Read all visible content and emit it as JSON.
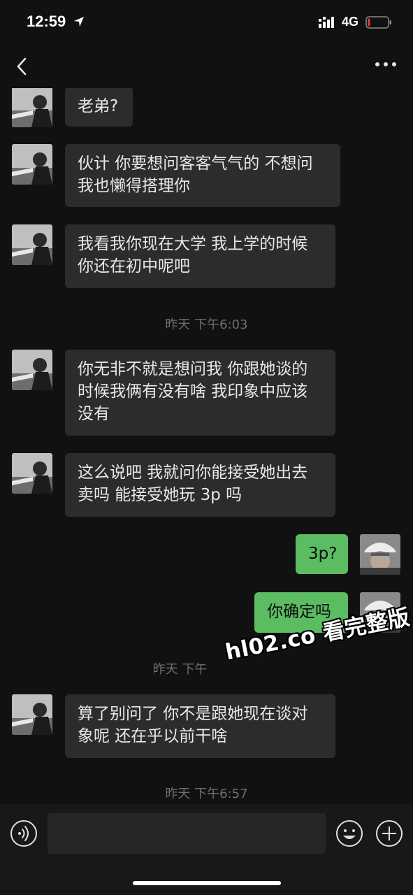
{
  "status_bar": {
    "time": "12:59",
    "network": "4G"
  },
  "colors": {
    "background": "#111111",
    "incoming_bubble": "#2c2c2c",
    "outgoing_bubble": "#5bbc62",
    "timestamp": "#6f6f6f"
  },
  "icons": {
    "back": "chevron-left-icon",
    "more": "more-dots-icon",
    "voice": "voice-icon",
    "emoji": "smile-icon",
    "add": "plus-icon"
  },
  "messages": [
    {
      "direction": "in",
      "text": "老弟?"
    },
    {
      "direction": "in",
      "line1": "伙计 你要想问客客气气的 不想问",
      "line2": "我也懒得搭理你"
    },
    {
      "direction": "in",
      "line1": "我看我你现在大学 我上学的时候",
      "line2": "你还在初中呢吧"
    },
    {
      "timestamp": "昨天 下午6:03"
    },
    {
      "direction": "in",
      "line1": "你无非不就是想问我 你跟她谈的",
      "line2": "时候我俩有没有啥 我印象中应该",
      "line3": "没有"
    },
    {
      "direction": "in",
      "line1": "这么说吧 我就问你能接受她出去",
      "line2": "卖吗 能接受她玩 3p 吗"
    },
    {
      "direction": "out",
      "text": "3p?"
    },
    {
      "direction": "out",
      "text": "你确定吗"
    },
    {
      "timestamp": "昨天 下午"
    },
    {
      "direction": "in",
      "line1": "算了别问了 你不是跟她现在谈对",
      "line2": "象呢 还在乎以前干啥"
    },
    {
      "timestamp": "昨天 下午6:57"
    }
  ],
  "watermark": "hl02.co 看完整版",
  "input": {
    "value": "",
    "placeholder": ""
  }
}
